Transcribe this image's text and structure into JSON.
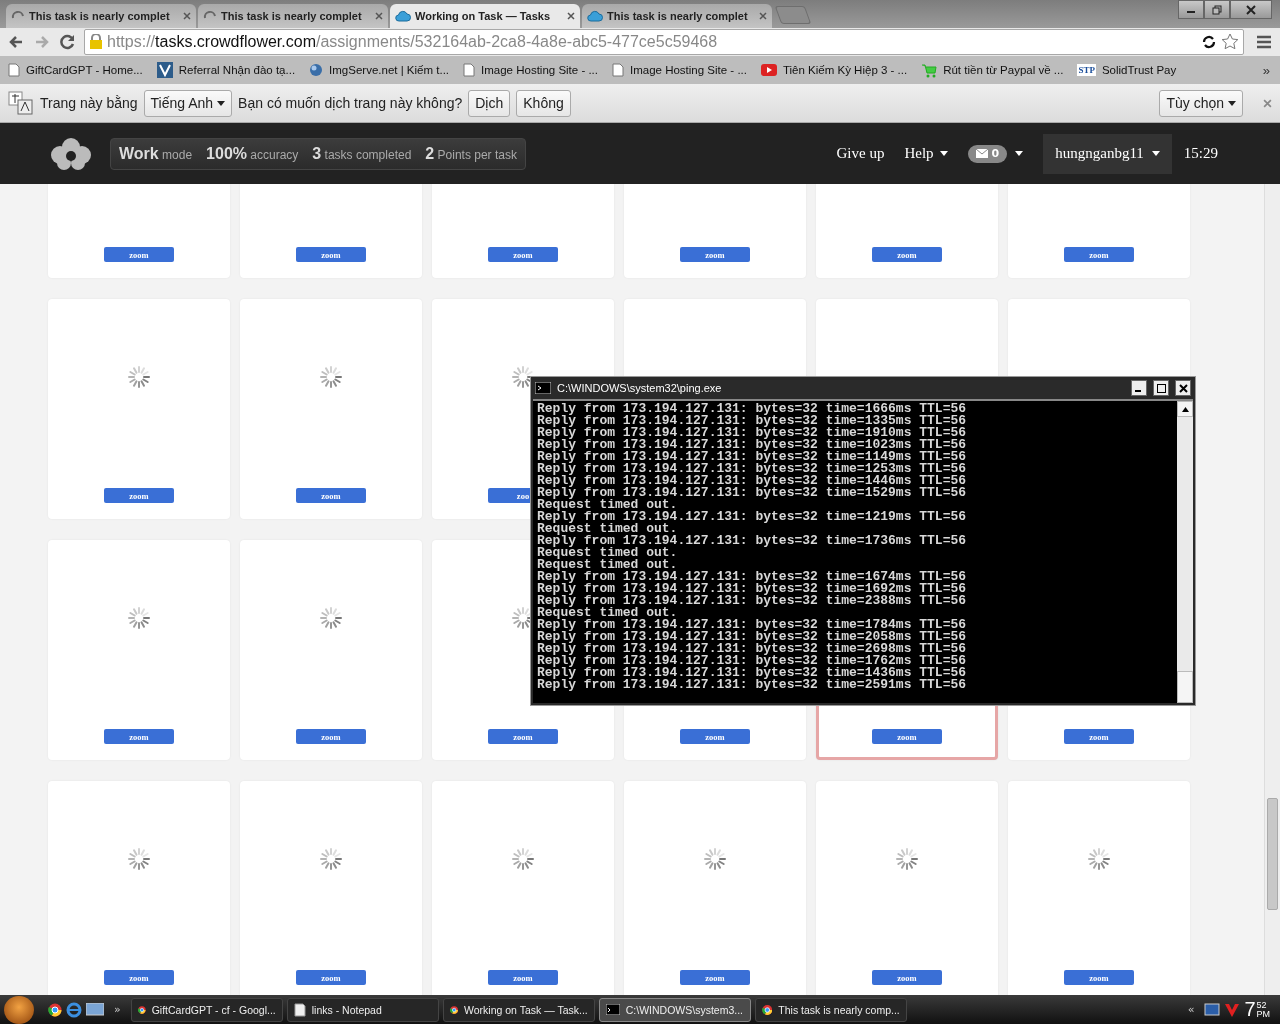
{
  "browser": {
    "tabs": [
      {
        "title": "This task is nearly complet",
        "selected": false,
        "loading": true
      },
      {
        "title": "This task is nearly complet",
        "selected": false,
        "loading": true
      },
      {
        "title": "Working on Task — Tasks",
        "selected": true,
        "loading": false
      },
      {
        "title": "This task is nearly complet",
        "selected": false,
        "loading": false
      }
    ],
    "url": {
      "scheme": "https://",
      "host": "tasks.crowdflower.com",
      "path": "/assignments/532164ab-2ca8-4a8e-abc5-477ce5c59468"
    },
    "bookmarks": [
      {
        "label": "GiftCardGPT - Home...",
        "kind": "page"
      },
      {
        "label": "Referral Nhận đào tạ...",
        "kind": "logo"
      },
      {
        "label": "ImgServe.net | Kiếm t...",
        "kind": "globe"
      },
      {
        "label": "Image Hosting Site - ...",
        "kind": "page"
      },
      {
        "label": "Image Hosting Site - ...",
        "kind": "page"
      },
      {
        "label": "Tiên Kiếm Kỳ Hiệp 3 - ...",
        "kind": "video"
      },
      {
        "label": "Rút tiền từ Paypal về ...",
        "kind": "cart"
      },
      {
        "label": "SolidTrust Pay",
        "kind": "badge",
        "badge_text": "STP"
      }
    ],
    "overflow": "»"
  },
  "translate_bar": {
    "prefix": "Trang này bằng",
    "language": "Tiếng Anh",
    "question": "Bạn có muốn dịch trang này không?",
    "buttons": [
      "Dịch",
      "Không"
    ],
    "options": "Tùy chọn"
  },
  "header": {
    "stats": [
      "**Work** mode",
      "**100%** accuracy",
      "**3** tasks completed",
      "**2** Points per task"
    ],
    "nav": [
      "Give up",
      "Help"
    ],
    "messages": "0",
    "user": "hungnganbg11",
    "time": "15:29"
  },
  "grid": {
    "cards": [
      {
        "selected": false,
        "button": "zoom"
      },
      {
        "selected": false,
        "button": "zoom"
      },
      {
        "selected": false,
        "button": "zoom"
      },
      {
        "selected": false,
        "button": "zoom"
      },
      {
        "selected": false,
        "button": "zoom"
      },
      {
        "selected": false,
        "button": "zoom"
      },
      {
        "loading": true,
        "selected": false,
        "button": "zoom"
      },
      {
        "loading": true,
        "selected": false,
        "button": "zoom"
      },
      {
        "loading": true,
        "selected": false,
        "button": "zoo"
      },
      {
        "selected": false
      },
      {
        "selected": false
      },
      {
        "selected": false
      },
      {
        "loading": true,
        "selected": false,
        "button": "zoom"
      },
      {
        "loading": true,
        "selected": false,
        "button": "zoom"
      },
      {
        "loading": true,
        "selected": false,
        "button": "zoom"
      },
      {
        "selected": false,
        "button": "zoom"
      },
      {
        "selected": true,
        "button": "zoom"
      },
      {
        "selected": false,
        "button": "zoom"
      },
      {
        "loading": true,
        "selected": false,
        "button": "zoom"
      },
      {
        "loading": true,
        "selected": false,
        "button": "zoom"
      },
      {
        "loading": true,
        "selected": false,
        "button": "zoom"
      },
      {
        "loading": true,
        "selected": false,
        "button": "zoom"
      },
      {
        "loading": true,
        "selected": false,
        "button": "zoom"
      },
      {
        "loading": true,
        "selected": false,
        "button": "zoom"
      }
    ]
  },
  "console": {
    "title": "C:\\WINDOWS\\system32\\ping.exe",
    "lines": [
      "Reply from 173.194.127.131: bytes=32 time=1666ms TTL=56",
      "Reply from 173.194.127.131: bytes=32 time=1335ms TTL=56",
      "Reply from 173.194.127.131: bytes=32 time=1910ms TTL=56",
      "Reply from 173.194.127.131: bytes=32 time=1023ms TTL=56",
      "Reply from 173.194.127.131: bytes=32 time=1149ms TTL=56",
      "Reply from 173.194.127.131: bytes=32 time=1253ms TTL=56",
      "Reply from 173.194.127.131: bytes=32 time=1446ms TTL=56",
      "Reply from 173.194.127.131: bytes=32 time=1529ms TTL=56",
      "Request timed out.",
      "Reply from 173.194.127.131: bytes=32 time=1219ms TTL=56",
      "Request timed out.",
      "Reply from 173.194.127.131: bytes=32 time=1736ms TTL=56",
      "Request timed out.",
      "Request timed out.",
      "Reply from 173.194.127.131: bytes=32 time=1674ms TTL=56",
      "Reply from 173.194.127.131: bytes=32 time=1692ms TTL=56",
      "Reply from 173.194.127.131: bytes=32 time=2388ms TTL=56",
      "Request timed out.",
      "Reply from 173.194.127.131: bytes=32 time=1784ms TTL=56",
      "Reply from 173.194.127.131: bytes=32 time=2058ms TTL=56",
      "Reply from 173.194.127.131: bytes=32 time=2698ms TTL=56",
      "Reply from 173.194.127.131: bytes=32 time=1762ms TTL=56",
      "Reply from 173.194.127.131: bytes=32 time=1436ms TTL=56",
      "Reply from 173.194.127.131: bytes=32 time=2591ms TTL=56"
    ]
  },
  "taskbar": {
    "overflow": "»",
    "items": [
      {
        "label": "GiftCardGPT - cf - Googl...",
        "kind": "chrome",
        "selected": false
      },
      {
        "label": "links - Notepad",
        "kind": "notepad",
        "selected": false
      },
      {
        "label": "Working on Task — Task...",
        "kind": "chrome",
        "selected": false
      },
      {
        "label": "C:\\WINDOWS\\system3...",
        "kind": "console",
        "selected": true
      },
      {
        "label": "This task is nearly comp...",
        "kind": "chrome",
        "selected": false
      }
    ],
    "tray_overflow": "«",
    "clock": {
      "hour": "7",
      "minute": "52",
      "period": "PM"
    }
  }
}
